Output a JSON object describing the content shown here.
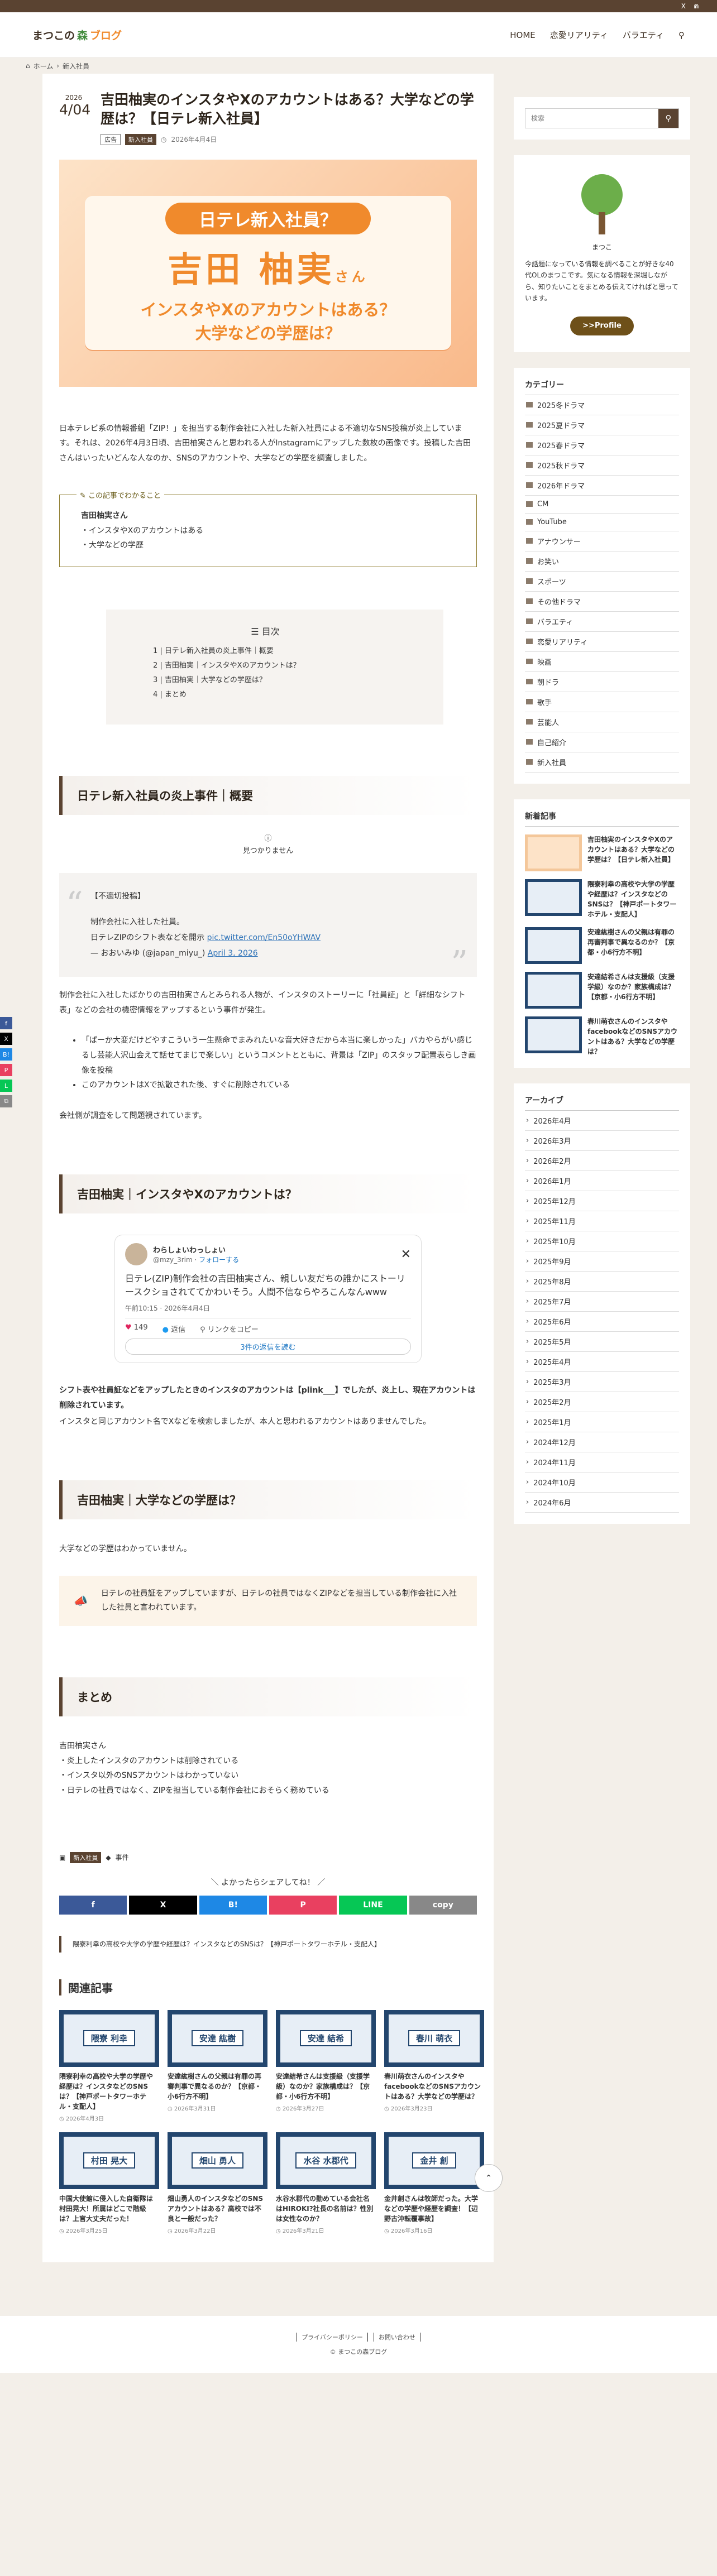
{
  "top_icons": [
    "X",
    "rss"
  ],
  "site": {
    "logo_pre": "まつこの",
    "logo_mid": "森",
    "logo_post": "ブログ"
  },
  "nav": [
    "HOME",
    "恋愛リアリティ",
    "バラエティ"
  ],
  "breadcrumb": [
    "ホーム",
    "新入社員"
  ],
  "post": {
    "year": "2026",
    "md": "4/04",
    "title": "吉田柚実のインスタやXのアカウントはある？大学などの学歴は？【日テレ新入社員】",
    "pr": "広告",
    "category": "新入社員",
    "date": "2026年4月4日"
  },
  "eyecatch": {
    "pill": "日テレ新入社員？",
    "name": "吉田 柚実",
    "san": "さん",
    "q1": "インスタやXのアカウントはある？",
    "q2": "大学などの学歴は？"
  },
  "intro": "日本テレビ系の情報番組「ZIP！」を担当する制作会社に入社した新入社員による不適切なSNS投稿が炎上しています。それは、2026年4月3日頃、吉田柚実さんと思われる人がInstagramにアップした数枚の画像です。投稿した吉田さんはいったいどんな人なのか、SNSのアカウントや、大学などの学歴を調査しました。",
  "summary": {
    "label": "この記事でわかること",
    "name": "吉田柚実さん",
    "items": [
      "インスタやXのアカウントはある",
      "大学などの学歴"
    ]
  },
  "toc": {
    "title": "目次",
    "items": [
      "日テレ新入社員の炎上事件｜概要",
      "吉田柚実｜インスタやXのアカウントは？",
      "吉田柚実｜大学などの学歴は？",
      "まとめ"
    ]
  },
  "sec1": {
    "heading": "日テレ新入社員の炎上事件｜概要",
    "notfound": "見つかりません",
    "quote": {
      "l1": "【不適切投稿】",
      "l2": "制作会社に入社した社員。",
      "l3": "日テレZIPのシフト表などを開示",
      "link": "pic.twitter.com/En50oYHWAV",
      "author": "— おおいみゆ (@japan_miyu_)",
      "date": "April 3, 2026"
    },
    "p1": "制作会社に入社したばかりの吉田柚実さんとみられる人物が、インスタのストーリーに「社員証」と「詳細なシフト表」などの会社の機密情報をアップするという事件が発生。",
    "bullets": [
      "「ぱーか大変だけどやすこういう一生懸命でまみれたいな音大好きだから本当に楽しかった」バカやらがい感じるし芸能人沢山会えて話せてまじで楽しい」というコメントとともに、背景は「ZIP」のスタッフ配置表らしき画像を投稿",
      "このアカウントはXで拡散された後、すぐに削除されている"
    ],
    "p2": "会社側が調査をして問題視されています。"
  },
  "sec2": {
    "heading": "吉田柚実｜インスタやXのアカウントは？",
    "tweet": {
      "name": "わらしょいわっしょい",
      "handle": "@mzy_3rim",
      "follow": "フォローする",
      "body": "日テレ(ZIP)制作会社の吉田柚実さん、親しい友だちの誰かにストーリースクショされててかわいそう。人間不信ならやろこんなんwww",
      "time": "午前10:15 · 2026年4月4日",
      "likes": "149",
      "reply": "返信",
      "copy": "リンクをコピー",
      "more": "3件の返信を読む"
    },
    "p1": "シフト表や社員証などをアップしたときのインスタのアカウントは【plink___】でしたが、炎上し、現在アカウントは削除されています。",
    "p2": "インスタと同じアカウント名でXなどを検索しましたが、本人と思われるアカウントはありませんでした。"
  },
  "sec3": {
    "heading": "吉田柚実｜大学などの学歴は？",
    "p1": "大学などの学歴はわかっていません。",
    "note": "日テレの社員証をアップしていますが、日テレの社員ではなくZIPなどを担当している制作会社に入社した社員と言われています。"
  },
  "sec4": {
    "heading": "まとめ",
    "name": "吉田柚実さん",
    "items": [
      "炎上したインスタのアカウントは削除されている",
      "インスタ以外のSNSアカウントはわかっていない",
      "日テレの社員ではなく、ZIPを担当している制作会社におそらく務めている"
    ]
  },
  "post_tags": {
    "cat": "新入社員",
    "tag": "事件"
  },
  "share": {
    "label": "よかったらシェアしてね！",
    "buttons": [
      "f",
      "X",
      "B!",
      "P",
      "LINE",
      "copy"
    ],
    "colors": [
      "#3b5998",
      "#000000",
      "#1e88e5",
      "#e94060",
      "#06c755",
      "#888888"
    ]
  },
  "prev": "隈寮利幸の高校や大学の学歴や経歴は？インスタなどのSNSは？【神戸ポートタワーホテル・支配人】",
  "related": {
    "heading": "関連記事",
    "items": [
      {
        "name": "隈寮 利幸",
        "title": "隈寮利幸の高校や大学の学歴や経歴は？インスタなどのSNSは？【神戸ポートタワーホテル・支配人】",
        "date": "2026年4月3日"
      },
      {
        "name": "安達 紘樹",
        "title": "安達紘樹さんの父親は有罪の再審判事で異なるのか？【京都・小6行方不明】",
        "date": "2026年3月31日"
      },
      {
        "name": "安達 結希",
        "title": "安達結希さんは支援級（支援学級）なのか？家族構成は？【京都・小6行方不明】",
        "date": "2026年3月27日"
      },
      {
        "name": "春川 萌衣",
        "title": "春川萌衣さんのインスタやfacebookなどのSNSアカウントはある？大学などの学歴は？",
        "date": "2026年3月23日"
      },
      {
        "name": "村田 晃大",
        "title": "中国大使館に侵入した自衛隊は村田晃大！所属はどこで階級は？上官大丈夫だった！",
        "date": "2026年3月25日"
      },
      {
        "name": "畑山 勇人",
        "title": "畑山勇人のインスタなどのSNSアカウントはある？高校では不良と一般だった？",
        "date": "2026年3月22日"
      },
      {
        "name": "水谷 水郡代",
        "title": "水谷水郡代の勤めている会社名はHIROKI?社長の名前は？性別は女性なのか？",
        "date": "2026年3月21日"
      },
      {
        "name": "金井 創",
        "title": "金井創さんは牧師だった。大学などの学歴や経歴を調査！【辺野古沖転覆事故】",
        "date": "2026年3月16日"
      }
    ]
  },
  "sidebar": {
    "search_placeholder": "検索",
    "profile_name": "まつこ",
    "profile_desc": "今話題になっている情報を調べることが好きな40代OLのまつこです。気になる情報を深堀しながら、知りたいことをまとめる伝えてければと思っています。",
    "profile_btn": ">>Profile",
    "cat_heading": "カテゴリー",
    "categories": [
      "2025冬ドラマ",
      "2025夏ドラマ",
      "2025春ドラマ",
      "2025秋ドラマ",
      "2026年ドラマ",
      "CM",
      "YouTube",
      "アナウンサー",
      "お笑い",
      "スポーツ",
      "その他ドラマ",
      "バラエティ",
      "恋愛リアリティ",
      "映画",
      "朝ドラ",
      "歌手",
      "芸能人",
      "自己紹介",
      "新入社員"
    ],
    "new_heading": "新着記事",
    "new_posts": [
      "吉田柚実のインスタやXのアカウントはある？大学などの学歴は？【日テレ新入社員】",
      "隈寮利幸の高校や大学の学歴や経歴は？インスタなどのSNSは？【神戸ポートタワーホテル・支配人】",
      "安達紘樹さんの父親は有罪の再審判事で異なるのか？【京都・小6行方不明】",
      "安達結希さんは支援級（支援学級）なのか？家族構成は？【京都・小6行方不明】",
      "春川萌衣さんのインスタやfacebookなどのSNSアカウントはある？大学などの学歴は？"
    ],
    "arc_heading": "アーカイブ",
    "archives": [
      "2026年4月",
      "2026年3月",
      "2026年2月",
      "2026年1月",
      "2025年12月",
      "2025年11月",
      "2025年10月",
      "2025年9月",
      "2025年8月",
      "2025年7月",
      "2025年6月",
      "2025年5月",
      "2025年4月",
      "2025年3月",
      "2025年2月",
      "2025年1月",
      "2024年12月",
      "2024年11月",
      "2024年10月",
      "2024年6月"
    ]
  },
  "footer": {
    "links": [
      "プライバシーポリシー",
      "お問い合わせ"
    ],
    "copy": "© まつこの森ブログ"
  }
}
